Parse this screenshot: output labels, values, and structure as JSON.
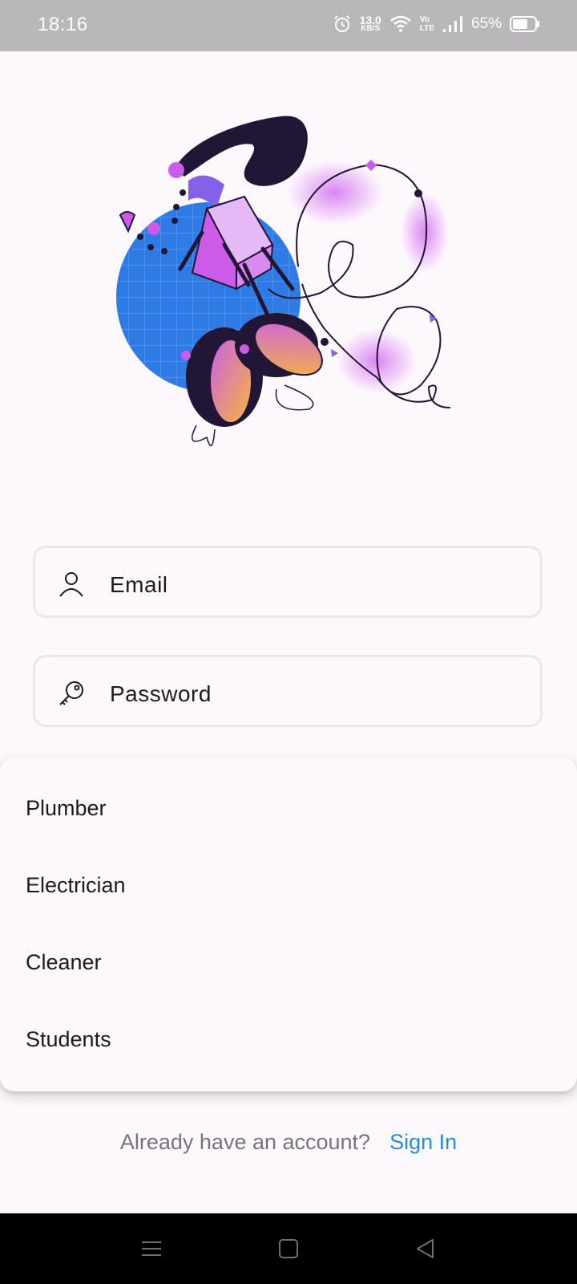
{
  "status_bar": {
    "time": "18:16",
    "net_speed_value": "13.0",
    "net_speed_unit": "KB/S",
    "volte_top": "Vo",
    "volte_bottom": "LTE",
    "battery": "65%",
    "icons": [
      "alarm-icon",
      "wifi-icon",
      "volte-icon",
      "signal-icon",
      "battery-icon"
    ]
  },
  "form": {
    "email_label": "Email",
    "password_label": "Password",
    "email_icon": "person-icon",
    "password_icon": "key-icon"
  },
  "dropdown": {
    "options": [
      "Plumber",
      "Electrician",
      "Cleaner",
      "Students"
    ]
  },
  "footer": {
    "question": "Already have an account?",
    "link": "Sign In",
    "link_color": "#2b8cd6"
  },
  "nav_bar": {
    "buttons": [
      "menu-icon",
      "home-icon",
      "back-icon"
    ]
  },
  "colors": {
    "background": "#fdf8fc",
    "status_bar": "#b9b7b9",
    "field_border": "#e9e7ea",
    "illustration_blue": "#2f7be6",
    "illustration_purple": "#cc5ce8",
    "illustration_dark": "#221637"
  }
}
